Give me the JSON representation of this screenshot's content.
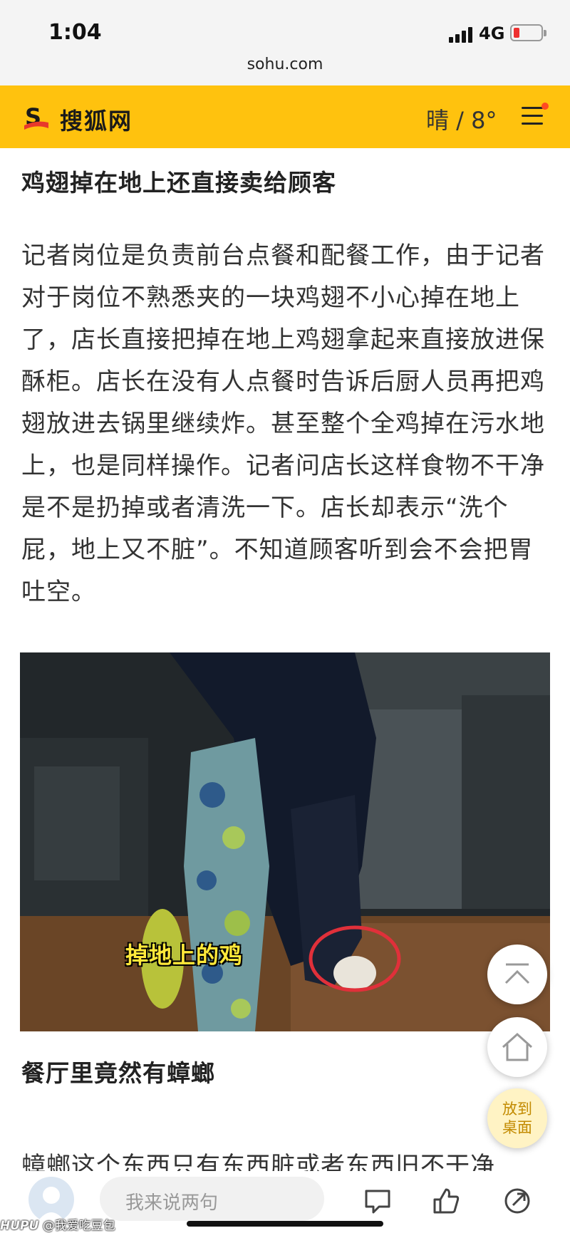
{
  "status": {
    "time": "1:04",
    "network": "4G",
    "url": "sohu.com"
  },
  "header": {
    "brand": "搜狐网",
    "weather": "晴 / 8°"
  },
  "article": {
    "section1_title": "鸡翅掉在地上还直接卖给顾客",
    "paragraph1": "记者岗位是负责前台点餐和配餐工作，由于记者对于岗位不熟悉夹的一块鸡翅不小心掉在地上了，店长直接把掉在地上鸡翅拿起来直接放进保酥柜。店长在没有人点餐时告诉后厨人员再把鸡翅放进去锅里继续炸。甚至整个全鸡掉在污水地上，也是同样操作。记者问店长这样食物不干净是不是扔掉或者清洗一下。店长却表示“洗个屁，地上又不脏”。不知道顾客听到会不会把胃吐空。",
    "image_caption": "掉地上的鸡",
    "section2_title": "餐厅里竟然有蟑螂",
    "paragraph2": "蟑螂这个东西只有东西脏或者东西旧不干净"
  },
  "fab": {
    "desktop_label_line1": "放到",
    "desktop_label_line2": "桌面"
  },
  "bottom": {
    "comment_placeholder": "我来说两句"
  },
  "watermark": {
    "brand": "HUPU",
    "user": "@我爱吃豆包"
  },
  "colors": {
    "header_bg": "#ffc20e",
    "brand_red": "#e8392b",
    "accent_orange": "#ff4a22"
  }
}
